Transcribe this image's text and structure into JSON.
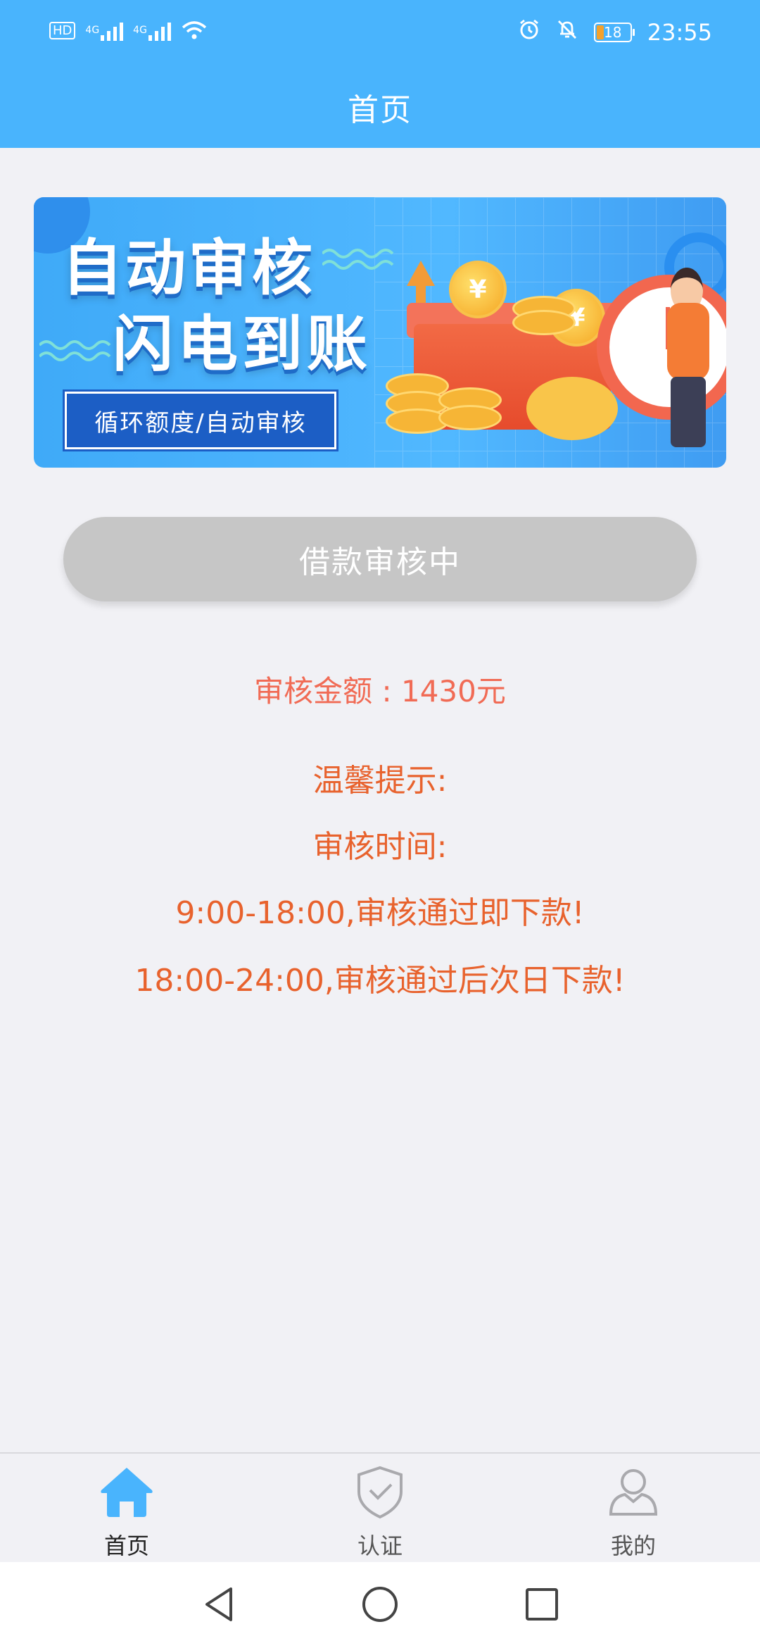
{
  "status_bar": {
    "left_indicators": [
      "HD",
      "4G",
      "4G",
      "wifi"
    ],
    "time": "23:55",
    "battery_level": "18",
    "icons": [
      "alarm-icon",
      "mute-icon",
      "battery-icon"
    ]
  },
  "header": {
    "title": "首页"
  },
  "banner": {
    "line1": "自动审核",
    "line2": "闪电到账",
    "tag": "循环额度/自动审核",
    "coin_symbol": "¥"
  },
  "loan_button": {
    "label": "借款审核中"
  },
  "review": {
    "amount_text": "审核金额 : 1430元"
  },
  "tips": {
    "title": "温馨提示:",
    "subtitle": "审核时间:",
    "line1": "9:00-18:00,审核通过即下款!",
    "line2": "18:00-24:00,审核通过后次日下款!"
  },
  "tabbar": {
    "items": [
      {
        "label": "首页",
        "icon": "home-icon",
        "active": true
      },
      {
        "label": "认证",
        "icon": "shield-check-icon",
        "active": false
      },
      {
        "label": "我的",
        "icon": "user-icon",
        "active": false
      }
    ]
  },
  "colors": {
    "primary": "#49b4fd",
    "tip_orange": "#e8622d",
    "amount_red": "#f16b55",
    "button_gray": "#c6c6c6"
  }
}
